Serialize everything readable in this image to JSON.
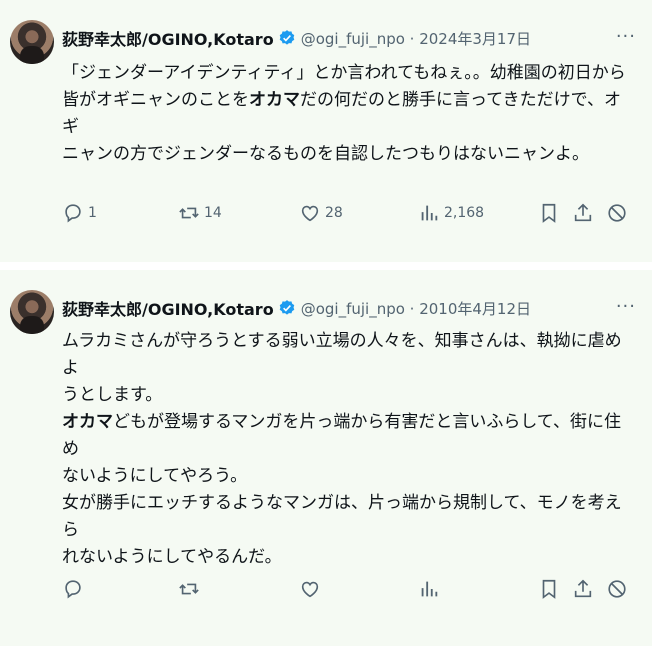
{
  "tweets": [
    {
      "name": "荻野幸太郎/OGINO,Kotaro",
      "handle_date": "@ogi_fuji_npo · 2024年3月17日",
      "more": "···",
      "lines": [
        {
          "parts": [
            {
              "t": "「ジェンダーアイデンティティ」とか言われてもねぇ。。幼稚園の初日から",
              "b": false
            }
          ]
        },
        {
          "parts": [
            {
              "t": "皆がオギニャンのことを",
              "b": false
            },
            {
              "t": "オカマ",
              "b": true
            },
            {
              "t": "だの何だのと勝手に言ってきただけで、オギ",
              "b": false
            }
          ]
        },
        {
          "parts": [
            {
              "t": "ニャンの方でジェンダーなるものを自認したつもりはないニャンよ。",
              "b": false
            }
          ]
        }
      ],
      "actions": {
        "reply": "1",
        "retweet": "14",
        "like": "28",
        "views": "2,168"
      }
    },
    {
      "name": "荻野幸太郎/OGINO,Kotaro",
      "handle_date": "@ogi_fuji_npo · 2010年4月12日",
      "more": "···",
      "lines": [
        {
          "parts": [
            {
              "t": "ムラカミさんが守ろうとする弱い立場の人々を、知事さんは、執拗に虐めよ",
              "b": false
            }
          ]
        },
        {
          "parts": [
            {
              "t": "うとします。",
              "b": false
            }
          ]
        },
        {
          "parts": [
            {
              "t": "オカマ",
              "b": true
            },
            {
              "t": "どもが登場するマンガを片っ端から有害だと言いふらして、街に住め",
              "b": false
            }
          ]
        },
        {
          "parts": [
            {
              "t": "ないようにしてやろう。",
              "b": false
            }
          ]
        },
        {
          "parts": [
            {
              "t": "女が勝手にエッチするようなマンガは、片っ端から規制して、モノを考えら",
              "b": false
            }
          ]
        },
        {
          "parts": [
            {
              "t": "れないようにしてやるんだ。",
              "b": false
            }
          ]
        }
      ],
      "actions": {
        "reply": "",
        "retweet": "",
        "like": "",
        "views": ""
      }
    }
  ],
  "colors": {
    "background": "#f5faf3",
    "verified": "#1d9bf0",
    "secondary_text": "#536471"
  },
  "icons": [
    "reply-icon",
    "retweet-icon",
    "like-icon",
    "views-icon",
    "bookmark-icon",
    "share-icon",
    "block-icon",
    "verified-badge-icon",
    "more-icon"
  ]
}
